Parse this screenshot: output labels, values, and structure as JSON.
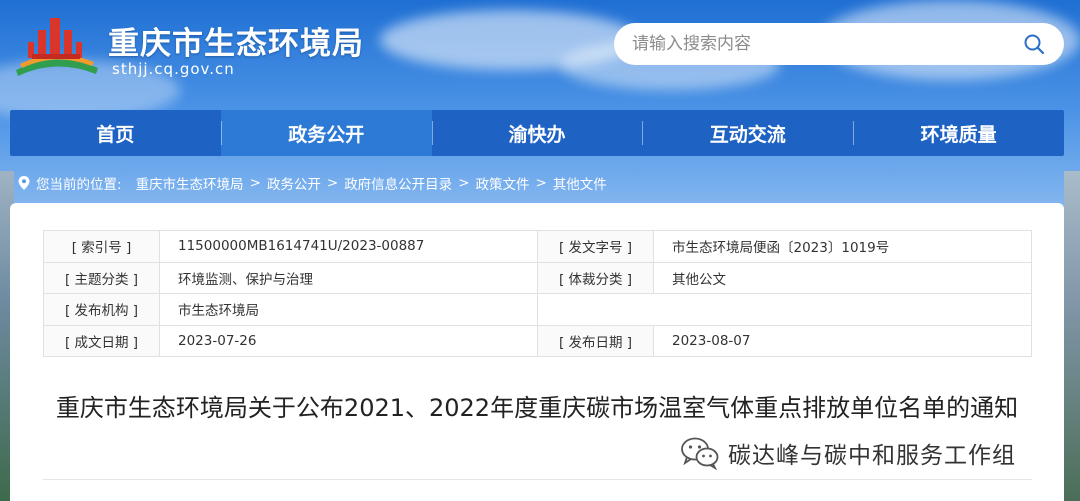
{
  "header": {
    "site_title": "重庆市生态环境局",
    "site_domain": "sthjj.cq.gov.cn",
    "logo_icon": "emblem-logo",
    "search": {
      "placeholder": "请输入搜索内容",
      "icon": "search-icon"
    }
  },
  "nav": {
    "items": [
      {
        "label": "首页",
        "active": false
      },
      {
        "label": "政务公开",
        "active": true
      },
      {
        "label": "渝快办",
        "active": false
      },
      {
        "label": "互动交流",
        "active": false
      },
      {
        "label": "环境质量",
        "active": false
      }
    ]
  },
  "breadcrumb": {
    "label": "您当前的位置:",
    "items": [
      "重庆市生态环境局",
      "政务公开",
      "政府信息公开目录",
      "政策文件",
      "其他文件"
    ],
    "separator": ">"
  },
  "meta": {
    "index_label": "[ 索引号 ]",
    "index_value": "11500000MB1614741U/2023-00887",
    "doc_no_label": "[ 发文字号 ]",
    "doc_no_value": "市生态环境局便函〔2023〕1019号",
    "topic_label": "[ 主题分类 ]",
    "topic_value": "环境监测、保护与治理",
    "genre_label": "[ 体裁分类 ]",
    "genre_value": "其他公文",
    "issuer_label": "[ 发布机构 ]",
    "issuer_value": "市生态环境局",
    "created_label": "[ 成文日期 ]",
    "created_value": "2023-07-26",
    "published_label": "[ 发布日期 ]",
    "published_value": "2023-08-07"
  },
  "document": {
    "title": "重庆市生态环境局关于公布2021、2022年度重庆碳市场温室气体重点排放单位名单的通知"
  },
  "watermark": {
    "text": "碳达峰与碳中和服务工作组",
    "icon": "wechat-icon"
  },
  "colors": {
    "nav_bg": "#1e63c4",
    "nav_active": "#2d7ad6",
    "logo_red": "#d9352a",
    "logo_orange": "#f29a2e",
    "logo_green": "#2f9e4f"
  }
}
